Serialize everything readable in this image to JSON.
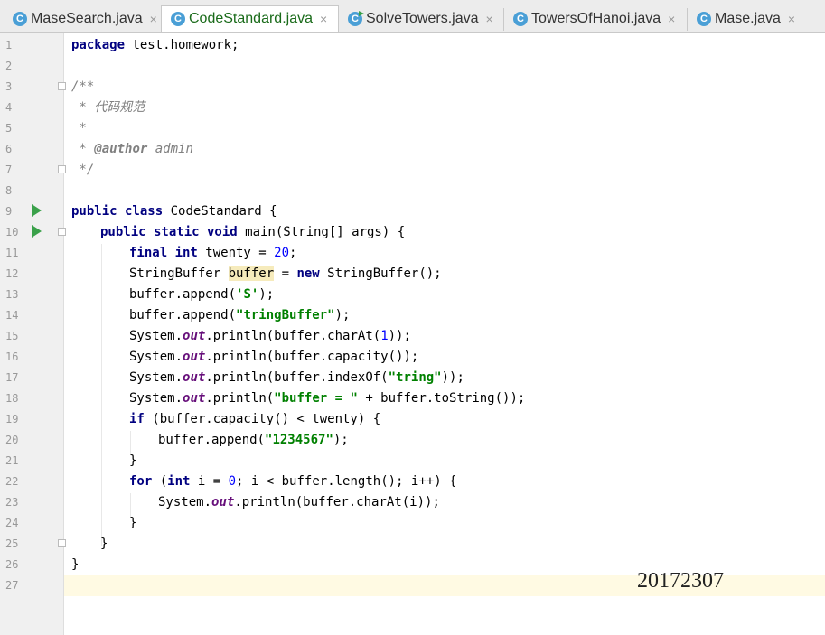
{
  "tabs": [
    {
      "label": "MaseSearch.java",
      "icon": "C"
    },
    {
      "label": "CodeStandard.java",
      "icon": "C"
    },
    {
      "label": "SolveTowers.java",
      "icon": "C"
    },
    {
      "label": "TowersOfHanoi.java",
      "icon": "C"
    },
    {
      "label": "Mase.java",
      "icon": "C"
    }
  ],
  "close_glyph": "×",
  "line_numbers": [
    "1",
    "2",
    "3",
    "4",
    "5",
    "6",
    "7",
    "8",
    "9",
    "10",
    "11",
    "12",
    "13",
    "14",
    "15",
    "16",
    "17",
    "18",
    "19",
    "20",
    "21",
    "22",
    "23",
    "24",
    "25",
    "26",
    "27"
  ],
  "code": {
    "l1_kw": "package",
    "l1_rest": " test.homework;",
    "l3": "/**",
    "l4": " * 代码规范",
    "l5": " *",
    "l6_pre": " * ",
    "l6_tag": "@author",
    "l6_post": " admin",
    "l7": " */",
    "l9_kw": "public class",
    "l9_rest": " CodeStandard {",
    "l10_kw": "public static void",
    "l10_rest": " main(String[] args) {",
    "l11_kw": "final int",
    "l11_mid": " twenty = ",
    "l11_num": "20",
    "l11_end": ";",
    "l12_a": "StringBuffer ",
    "l12_hl": "buffer",
    "l12_b": " = ",
    "l12_kw": "new",
    "l12_c": " StringBuffer();",
    "l13_a": "buffer.append(",
    "l13_str": "'S'",
    "l13_b": ");",
    "l14_a": "buffer.append(",
    "l14_str": "\"tringBuffer\"",
    "l14_b": ");",
    "l15_a": "System.",
    "l15_fld": "out",
    "l15_b": ".println(buffer.charAt(",
    "l15_num": "1",
    "l15_c": "));",
    "l16_a": "System.",
    "l16_fld": "out",
    "l16_b": ".println(buffer.capacity());",
    "l17_a": "System.",
    "l17_fld": "out",
    "l17_b": ".println(buffer.indexOf(",
    "l17_str": "\"tring\"",
    "l17_c": "));",
    "l18_a": "System.",
    "l18_fld": "out",
    "l18_b": ".println(",
    "l18_str": "\"buffer = \"",
    "l18_c": " + buffer.toString());",
    "l19_kw": "if",
    "l19_rest": " (buffer.capacity() < twenty) {",
    "l20_a": "buffer.append(",
    "l20_str": "\"1234567\"",
    "l20_b": ");",
    "l21": "}",
    "l22_kw": "for",
    "l22_a": " (",
    "l22_kw2": "int",
    "l22_b": " i = ",
    "l22_num": "0",
    "l22_c": "; i < buffer.length(); i++) {",
    "l23_a": "System.",
    "l23_fld": "out",
    "l23_b": ".println(buffer.charAt(i));",
    "l24": "}",
    "l25": "}",
    "l26": "}"
  },
  "student_id": "20172307"
}
